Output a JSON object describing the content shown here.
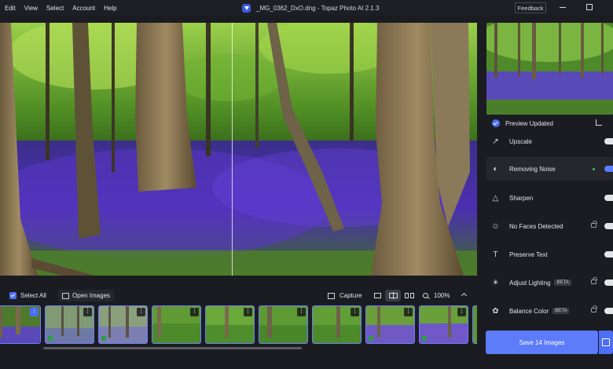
{
  "menu": [
    "Edit",
    "View",
    "Select",
    "Account",
    "Help"
  ],
  "window": {
    "title": "_MG_0362_DxO.dng - Topaz Photo AI 2.1.3",
    "feedback_label": "Feedback"
  },
  "toolbar": {
    "select_all_label": "Select All",
    "open_images_label": "Open Images",
    "capture_label": "Capture",
    "zoom_value": "100%"
  },
  "preview": {
    "status_label": "Preview Updated"
  },
  "models": [
    {
      "label": "Upscale",
      "icon": "upscale-icon",
      "state": "off"
    },
    {
      "label": "Removing Noise",
      "icon": "noise-icon",
      "state": "on"
    },
    {
      "label": "Sharpen",
      "icon": "sharpen-icon",
      "state": "off"
    },
    {
      "label": "No Faces Detected",
      "icon": "face-icon",
      "state": "locked"
    },
    {
      "label": "Preserve Text",
      "icon": "text-icon",
      "state": "off"
    },
    {
      "label": "Adjust Lighting",
      "icon": "lighting-icon",
      "state": "locked",
      "badge": "BETA"
    },
    {
      "label": "Balance Color",
      "icon": "color-icon",
      "state": "locked",
      "badge": "BETA"
    }
  ],
  "save": {
    "label": "Save 14 Images"
  },
  "colors": {
    "accent": "#5c7cfa",
    "panel": "#1b1c21",
    "active_row": "#26272d"
  }
}
